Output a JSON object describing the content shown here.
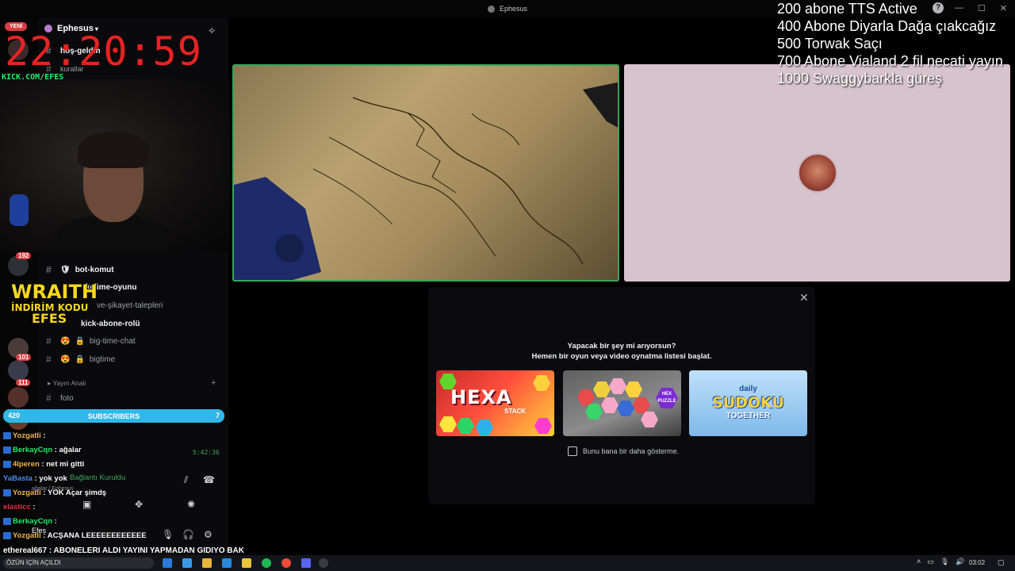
{
  "window": {
    "title": "Ephesus",
    "controls": [
      "—",
      "☐",
      "✕"
    ]
  },
  "overlay": {
    "new_badge": "YENİ",
    "clock": "22:20:59",
    "clock_sub": "KICK.COM/EFES",
    "goals": [
      "200 abone TTS Active",
      "400 Abone Diyarla Dağa çıakcağız",
      "500 Torwak Saçı",
      "700 Abone Vialand 2 fil necati yayın",
      "1000 Swaggybarkla güreş"
    ],
    "wraith": {
      "line1": "WRAITH",
      "line2": "İNDİRİM KODU",
      "line3": "EFES"
    },
    "subscribers": {
      "left": "420",
      "label": "SUBSCRIBERS",
      "right": "7"
    },
    "chat": [
      {
        "user": "Yozgatli",
        "message": " : ",
        "color": "#f0b84a"
      },
      {
        "user": "BerkayCqn",
        "message": " : ağalar",
        "color": "#1ef36a"
      },
      {
        "user": "4lperen",
        "message": " : net mi gitti",
        "color": "#f0b84a"
      },
      {
        "user": "YaBasta",
        "message": " : yok yok",
        "color": "#4a8df0"
      },
      {
        "user": "Yozgatli",
        "message": " : YOK Açar şimdş",
        "color": "#f0b84a"
      },
      {
        "user": "elasticc",
        "message": " : ",
        "color": "#e8324a"
      },
      {
        "user": "BerkayCqn",
        "message": " : ",
        "color": "#1ef36a"
      },
      {
        "user": "Yozgatli",
        "message": " : ACŞANA LEEEEEEEEEEEE",
        "color": "#f0b84a"
      }
    ],
    "ethereal": "ethereal667 : ABONELERI ALDI YAYINI YAPMADAN GIDIYO BAK",
    "chat_timestamp": "5:42:36"
  },
  "sidebar": {
    "server_name": "Ephesus",
    "channels_top": [
      {
        "name": "hoş-geldin",
        "bold": true
      },
      {
        "name": "kurallar",
        "bold": false
      }
    ],
    "channels": [
      {
        "name": "bot-komut",
        "emoji": "🛡",
        "bold": true
      },
      {
        "name": "kelime-oyunu",
        "emoji": "",
        "bold": true
      },
      {
        "name": "ve-şikayet-talepleri",
        "emoji": "",
        "bold": false
      },
      {
        "name": "kick-abone-rolü",
        "emoji": "",
        "bold": true
      },
      {
        "name": "big-time-chat",
        "emoji": "😍",
        "bold": false
      },
      {
        "name": "bigtime",
        "emoji": "😍",
        "bold": false
      }
    ],
    "category": "Yayın Analı",
    "foto_channel": "foto",
    "voice_status": "Bağlantı Kuruldu",
    "voice_sub": "ağalar / Ephesus",
    "user_name": "Efes",
    "badges": [
      "192",
      "7",
      "101",
      "111"
    ]
  },
  "activity": {
    "title_line1": "Yapacak bir şey mi arıyorsun?",
    "title_line2": "Hemen bir oyun veya video oynatma listesi başlat.",
    "games": [
      {
        "name": "HEXA",
        "sub": "STACK"
      },
      {
        "name": "HEX PUZZLE"
      },
      {
        "line1": "daily",
        "line2": "SUDOKU",
        "line3": "TOGETHER"
      }
    ],
    "dont_show": "Bunu bana bir daha gösterme."
  },
  "taskbar": {
    "search": "ÖZÜN İÇİN AÇILDI",
    "time": "03:02"
  }
}
